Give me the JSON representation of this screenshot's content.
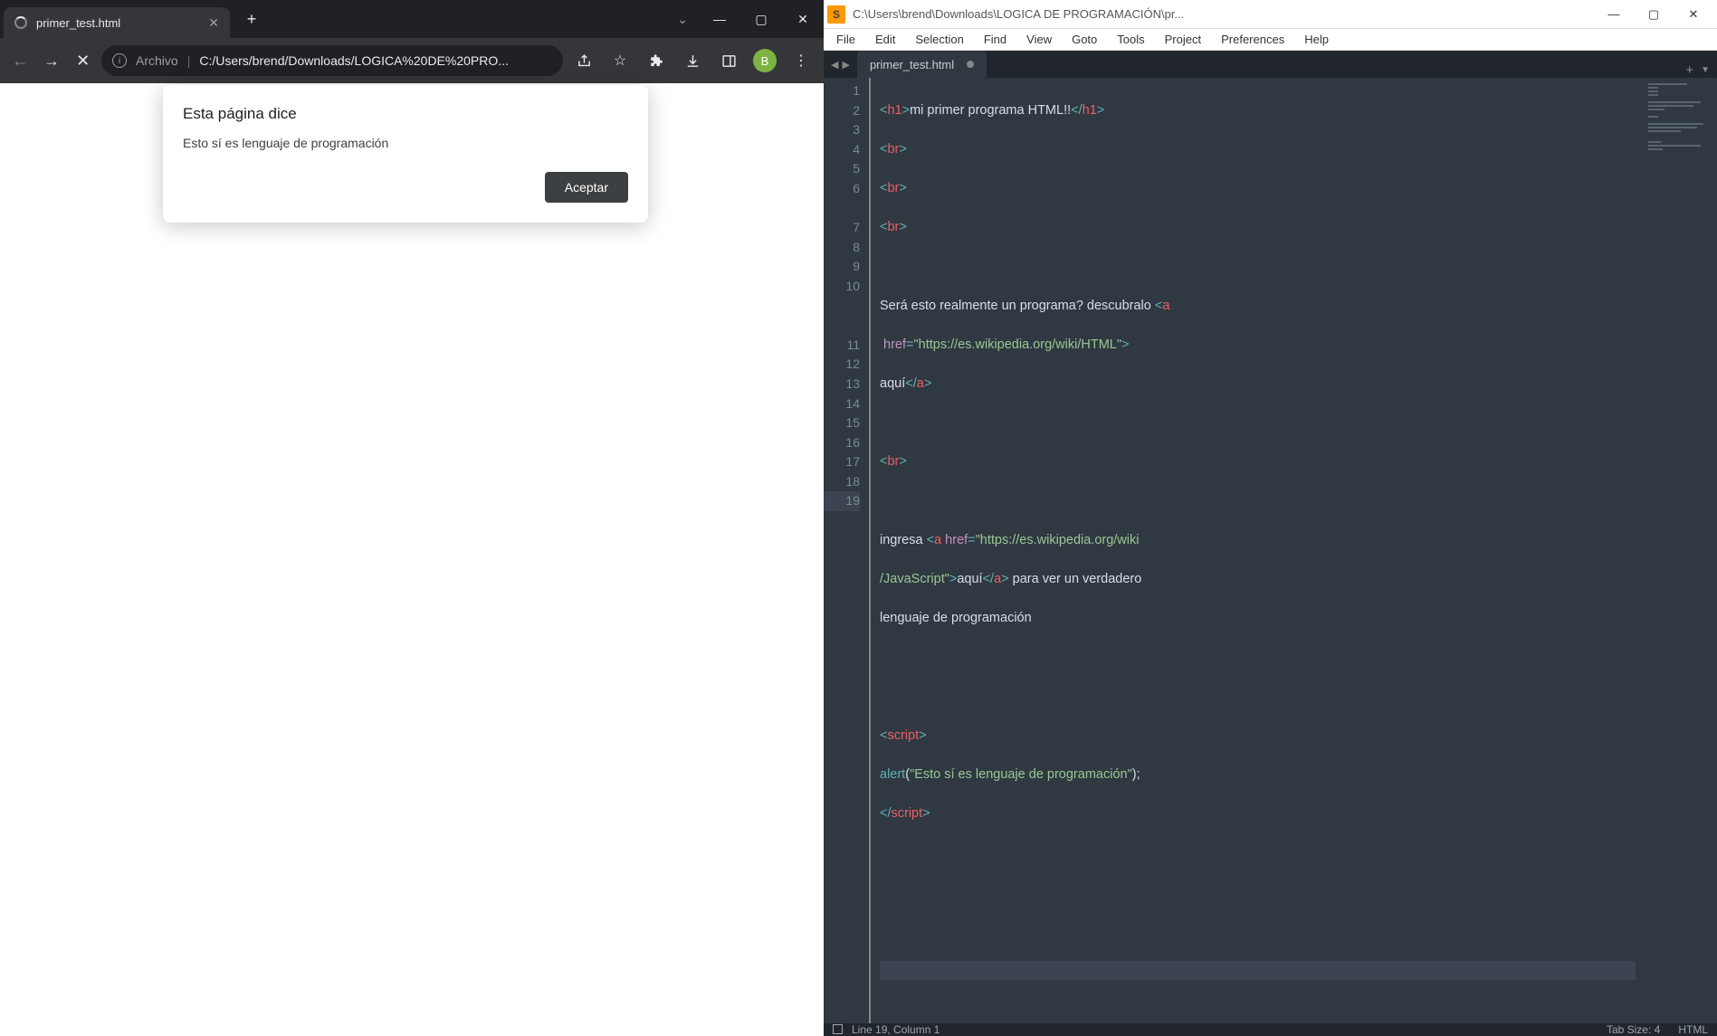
{
  "browser": {
    "tab_title": "primer_test.html",
    "address": {
      "protocol": "Archivo",
      "path": "C:/Users/brend/Downloads/LOGICA%20DE%20PRO..."
    },
    "avatar_initial": "B",
    "dialog": {
      "title": "Esta página dice",
      "message": "Esto sí es lenguaje de programación",
      "accept": "Aceptar"
    }
  },
  "sublime": {
    "window_title": "C:\\Users\\brend\\Downloads\\LOGICA DE PROGRAMACIÓN\\pr...",
    "menu": [
      "File",
      "Edit",
      "Selection",
      "Find",
      "View",
      "Goto",
      "Tools",
      "Project",
      "Preferences",
      "Help"
    ],
    "tab_name": "primer_test.html",
    "code": {
      "l1_text": "mi primer programa HTML!!",
      "l6_text_a": "Será esto realmente un programa? descubralo ",
      "l6_href": "\"https://es.wikipedia.org/wiki/HTML\"",
      "l6_link": "aquí",
      "l10_text_a": "ingresa ",
      "l10_href": "\"https://es.wikipedia.org/wiki",
      "l10_text_b": "/JavaScript\"",
      "l10_link": "aquí",
      "l10_text_c": " para ver un verdadero",
      "l10_text_d": "lenguaje de programación",
      "l14_alert": "\"Esto sí es lenguaje de programación\""
    },
    "line_numbers": [
      "1",
      "2",
      "3",
      "4",
      "5",
      "6",
      "",
      "7",
      "8",
      "9",
      "10",
      "",
      "",
      "11",
      "12",
      "13",
      "14",
      "15",
      "16",
      "17",
      "18",
      "19"
    ],
    "status": {
      "position": "Line 19, Column 1",
      "tab_size": "Tab Size: 4",
      "syntax": "HTML"
    }
  }
}
